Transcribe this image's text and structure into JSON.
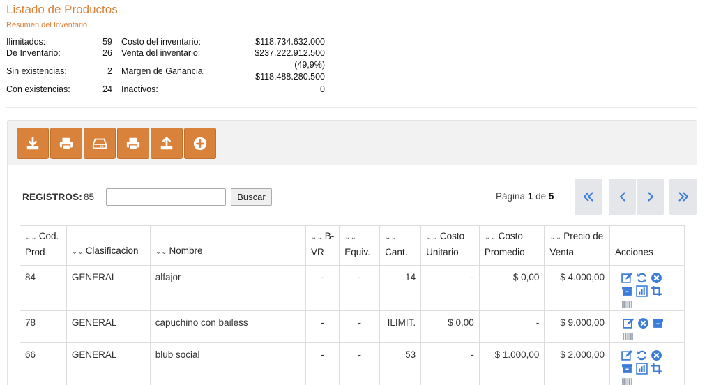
{
  "page": {
    "title": "Listado de Productos",
    "subtitle": "Resumen del Inventario"
  },
  "summary": {
    "ilimitados_label": "Ilimitados:",
    "ilimitados_value": "59",
    "inventario_label": "De Inventario:",
    "inventario_value": "26",
    "sin_label": "Sin existencias:",
    "sin_value": "2",
    "con_label": "Con existencias:",
    "con_value": "24",
    "costo_label": "Costo del inventario:",
    "costo_value": "$118.734.632.000",
    "venta_label": "Venta del inventario:",
    "venta_value": "$237.222.912.500",
    "margen_label": "Margen de Ganancia:",
    "margen_pct": "(49,9%)",
    "margen_value": "$118.488.280.500",
    "inactivos_label": "Inactivos:",
    "inactivos_value": "0"
  },
  "toolbar": {
    "color": "#d9823b",
    "buttons": [
      "download-icon",
      "print-icon",
      "drive-icon",
      "print-icon",
      "upload-icon",
      "plus-circle-icon"
    ]
  },
  "search": {
    "registros_label": "REGISTROS:",
    "registros_count": "85",
    "value": "",
    "placeholder": "",
    "button_label": "Buscar"
  },
  "pager": {
    "prefix": "Página",
    "current": "1",
    "of_word": "de",
    "total": "5"
  },
  "table": {
    "headers": [
      "Cod. Prod",
      "Clasificacion",
      "Nombre",
      "B-VR",
      "Equiv.",
      "Cant.",
      "Costo Unitario",
      "Costo Promedio",
      "Precio de Venta",
      "Acciones"
    ],
    "rows": [
      {
        "cod": "84",
        "clasificacion": "GENERAL",
        "nombre": "alfajor",
        "bvr": "-",
        "equiv": "-",
        "cant": "14",
        "costo_unitario": "-",
        "costo_promedio": "$ 0,00",
        "precio_venta": "$ 4.000,00"
      },
      {
        "cod": "78",
        "clasificacion": "GENERAL",
        "nombre": "capuchino con bailess",
        "bvr": "-",
        "equiv": "-",
        "cant": "ILIMIT.",
        "costo_unitario": "$ 0,00",
        "costo_promedio": "-",
        "precio_venta": "$ 9.000,00"
      },
      {
        "cod": "66",
        "clasificacion": "GENERAL",
        "nombre": "blub social",
        "bvr": "-",
        "equiv": "-",
        "cant": "53",
        "costo_unitario": "-",
        "costo_promedio": "$ 1.000,00",
        "precio_venta": "$ 2.000,00"
      }
    ]
  },
  "colors": {
    "accent": "#d9823b",
    "action_icon": "#3b7bd9",
    "pager_bg": "#e4e6ea"
  }
}
